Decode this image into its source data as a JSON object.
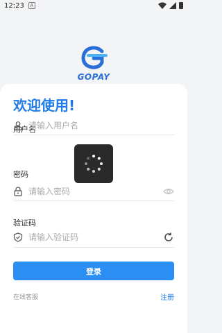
{
  "status": {
    "time": "12:23",
    "notification": "A"
  },
  "brand": {
    "name": "GOPAY",
    "color": "#2a6fd8"
  },
  "welcome": "欢迎使用!",
  "fields": {
    "username": {
      "label": "用户名",
      "placeholder": "请输入用户名"
    },
    "password": {
      "label": "密码",
      "placeholder": "请输入密码"
    },
    "captcha": {
      "label": "验证码",
      "placeholder": "请输入验证码"
    }
  },
  "actions": {
    "login": "登录",
    "support": "在线客服",
    "register": "注册"
  },
  "colors": {
    "accent": "#1f7be8",
    "button": "#2b8ef3"
  },
  "icons": [
    "user-icon",
    "lock-icon",
    "eye-icon",
    "shield-icon",
    "refresh-icon",
    "loading-spinner-icon"
  ]
}
